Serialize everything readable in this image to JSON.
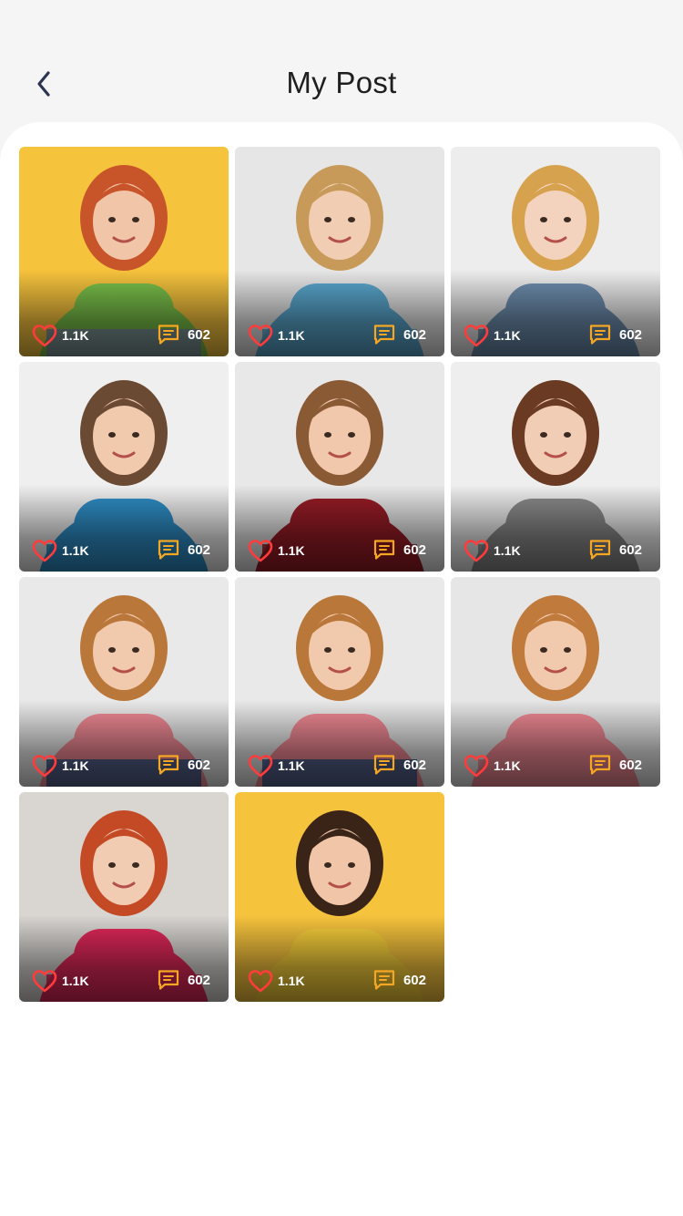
{
  "header": {
    "title": "My Post",
    "back_icon": "chevron-left-icon"
  },
  "colors": {
    "heart": "#ff3b3b",
    "comment": "#f5a623",
    "title": "#1f1f1f"
  },
  "posts": [
    {
      "likes": "1.1K",
      "comments": "602",
      "bg": "#f6c33d",
      "shirt": "#7bc24a",
      "hair": "#c8552a",
      "skin": "#f1c6a8",
      "pants": "#7f8da3"
    },
    {
      "likes": "1.1K",
      "comments": "602",
      "bg": "#e6e6e6",
      "shirt": "#5aa8cf",
      "hair": "#c89a5a",
      "skin": "#f0cdb3",
      "pants": "#5aa8cf"
    },
    {
      "likes": "1.1K",
      "comments": "602",
      "bg": "#ededed",
      "shirt": "#6f8fb0",
      "hair": "#d7a24e",
      "skin": "#f3d3bd",
      "pants": "#6f8fb0"
    },
    {
      "likes": "1.1K",
      "comments": "602",
      "bg": "#efefef",
      "shirt": "#2f8fc8",
      "hair": "#6b4a33",
      "skin": "#f1c9ad",
      "pants": "#2f8fc8"
    },
    {
      "likes": "1.1K",
      "comments": "602",
      "bg": "#e8e8e8",
      "shirt": "#9a1c26",
      "hair": "#8a5a35",
      "skin": "#f1c8ab",
      "pants": "#9a1c26"
    },
    {
      "likes": "1.1K",
      "comments": "602",
      "bg": "#eeeeee",
      "shirt": "#8c8c8c",
      "hair": "#6a3a22",
      "skin": "#f2cdb5",
      "pants": "#8c8c8c"
    },
    {
      "likes": "1.1K",
      "comments": "602",
      "bg": "#e9e9e9",
      "shirt": "#f28a95",
      "hair": "#b9773a",
      "skin": "#f1c9ad",
      "pants": "#3b5c8c"
    },
    {
      "likes": "1.1K",
      "comments": "602",
      "bg": "#e9e9e9",
      "shirt": "#f28a95",
      "hair": "#b9773a",
      "skin": "#f1c9ad",
      "pants": "#3b5c8c"
    },
    {
      "likes": "1.1K",
      "comments": "602",
      "bg": "#e6e6e6",
      "shirt": "#f28a95",
      "hair": "#c07a3c",
      "skin": "#f1c9ad",
      "pants": "#f28a95"
    },
    {
      "likes": "1.1K",
      "comments": "602",
      "bg": "#d9d6d2",
      "shirt": "#e2285a",
      "hair": "#c44a25",
      "skin": "#f2cbb3",
      "pants": "#e2285a"
    },
    {
      "likes": "1.1K",
      "comments": "602",
      "bg": "#f6c33d",
      "shirt": "#f7cf3a",
      "hair": "#3a2418",
      "skin": "#f1c6a8",
      "pants": "#f7cf3a"
    }
  ]
}
